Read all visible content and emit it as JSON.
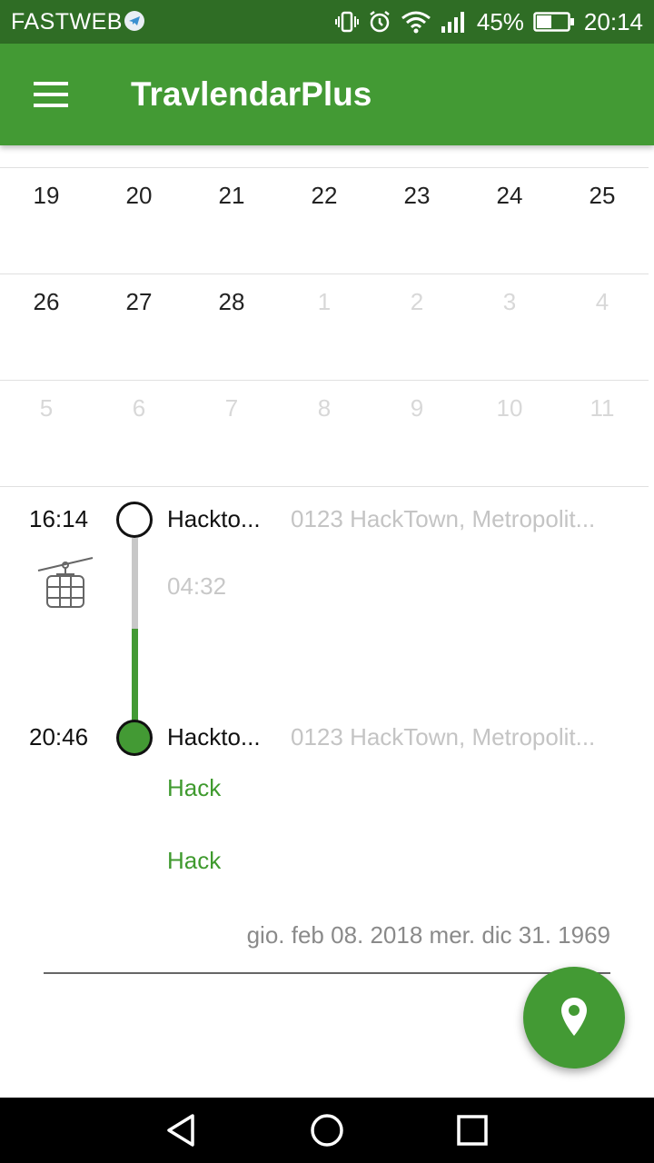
{
  "status_bar": {
    "carrier": "FASTWEB",
    "battery": "45%",
    "time": "20:14"
  },
  "app_bar": {
    "title": "TravlendarPlus"
  },
  "calendar": {
    "weeks": [
      [
        {
          "d": "19",
          "other": false
        },
        {
          "d": "20",
          "other": false
        },
        {
          "d": "21",
          "other": false
        },
        {
          "d": "22",
          "other": false
        },
        {
          "d": "23",
          "other": false
        },
        {
          "d": "24",
          "other": false
        },
        {
          "d": "25",
          "other": false
        }
      ],
      [
        {
          "d": "26",
          "other": false
        },
        {
          "d": "27",
          "other": false
        },
        {
          "d": "28",
          "other": false
        },
        {
          "d": "1",
          "other": true
        },
        {
          "d": "2",
          "other": true
        },
        {
          "d": "3",
          "other": true
        },
        {
          "d": "4",
          "other": true
        }
      ],
      [
        {
          "d": "5",
          "other": true
        },
        {
          "d": "6",
          "other": true
        },
        {
          "d": "7",
          "other": true
        },
        {
          "d": "8",
          "other": true
        },
        {
          "d": "9",
          "other": true
        },
        {
          "d": "10",
          "other": true
        },
        {
          "d": "11",
          "other": true
        }
      ]
    ]
  },
  "trip": {
    "departure": {
      "time": "16:14",
      "name": "Hackto...",
      "address": "0123 HackTown, Metropolit..."
    },
    "duration": "04:32",
    "transport": "cable-car-icon",
    "arrival": {
      "time": "20:46",
      "name": "Hackto...",
      "address": "0123 HackTown, Metropolit..."
    },
    "events": [
      "Hack",
      "Hack"
    ],
    "date_range": "gio. feb 08. 2018 mer. dic 31. 1969"
  },
  "colors": {
    "accent": "#439a34",
    "status_bar": "#2f6d25"
  }
}
